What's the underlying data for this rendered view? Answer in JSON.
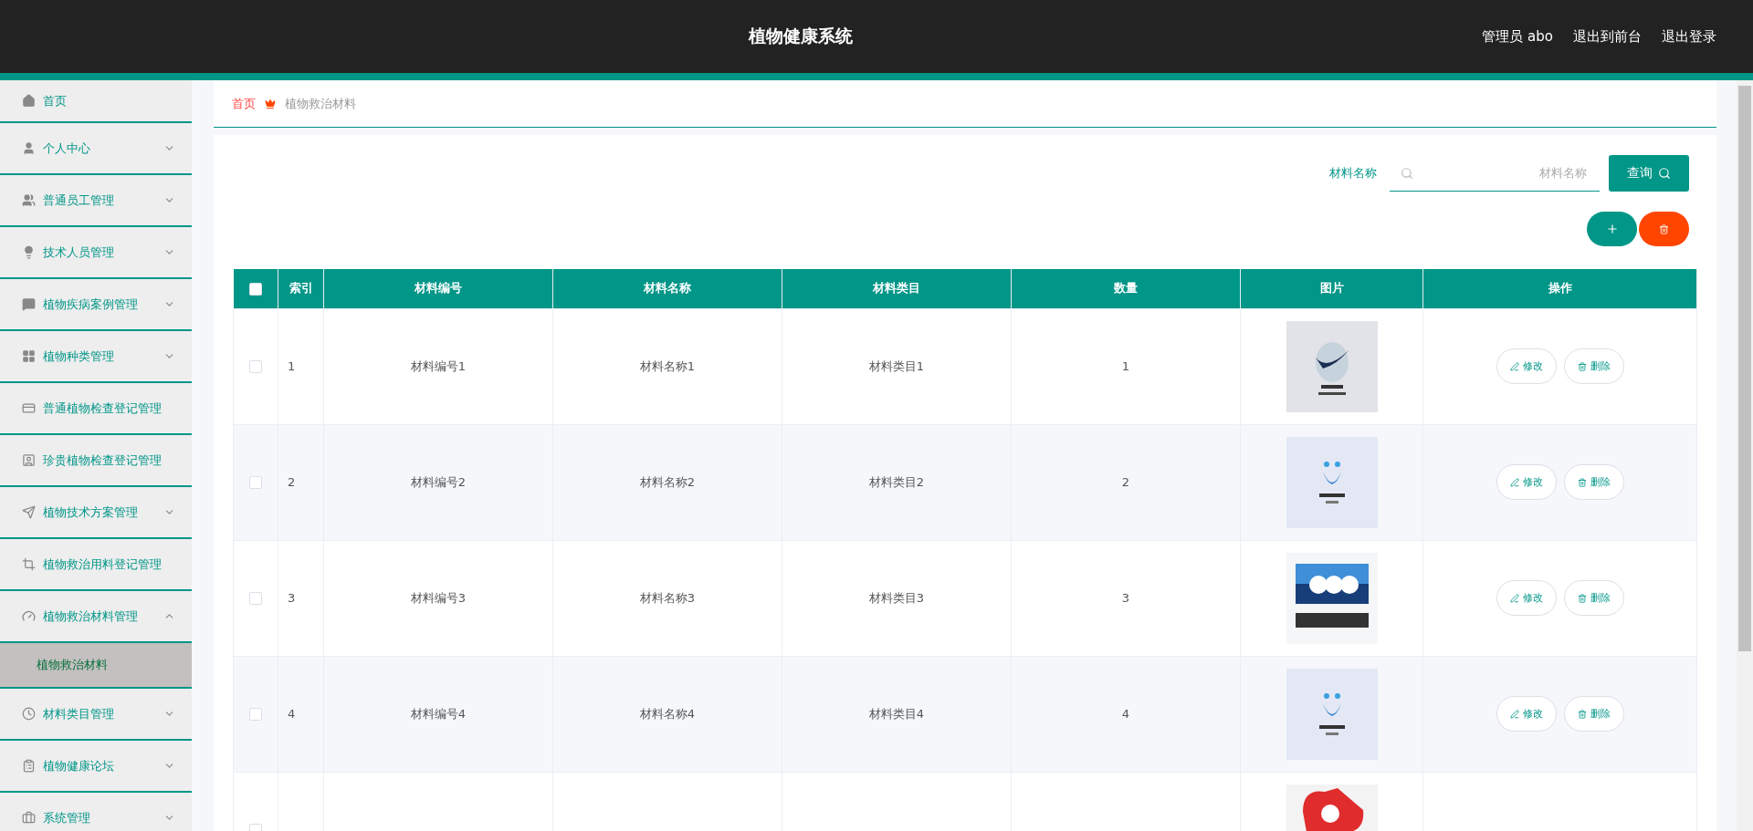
{
  "header": {
    "title": "植物健康系统",
    "links": [
      "管理员 abo",
      "退出到前台",
      "退出登录"
    ]
  },
  "sidebar": {
    "items": [
      {
        "label": "首页"
      },
      {
        "label": "个人中心",
        "expanded": false
      },
      {
        "label": "普通员工管理",
        "expanded": false
      },
      {
        "label": "技术人员管理",
        "expanded": false
      },
      {
        "label": "植物疾病案例管理",
        "expanded": false
      },
      {
        "label": "植物种类管理",
        "expanded": false
      },
      {
        "label": "普通植物检查登记管理"
      },
      {
        "label": "珍贵植物检查登记管理"
      },
      {
        "label": "植物技术方案管理",
        "expanded": false
      },
      {
        "label": "植物救治用料登记管理"
      },
      {
        "label": "植物救治材料管理",
        "expanded": true,
        "children": [
          {
            "label": "植物救治材料",
            "selected": true
          }
        ]
      },
      {
        "label": "材料类目管理",
        "expanded": false
      },
      {
        "label": "植物健康论坛",
        "expanded": false
      },
      {
        "label": "系统管理",
        "expanded": false
      }
    ]
  },
  "breadcrumb": [
    "首页",
    "植物救治材料"
  ],
  "search": {
    "label": "材料名称",
    "placeholder": "材料名称",
    "button": "查询"
  },
  "table": {
    "columns": [
      "索引",
      "材料编号",
      "材料名称",
      "材料类目",
      "数量",
      "图片",
      "操作"
    ],
    "header_checked": false,
    "rows": [
      {
        "checked": false,
        "cells": [
          "1",
          "材料编号1",
          "材料名称1",
          "材料类目1",
          "1"
        ],
        "image": {
          "kind": "picture"
        },
        "actions": [
          "修改",
          "删除"
        ]
      },
      {
        "checked": false,
        "cells": [
          "2",
          "材料编号2",
          "材料名称2",
          "材料类目2",
          "2"
        ],
        "image": {
          "kind": "picture"
        },
        "actions": [
          "修改",
          "删除"
        ]
      },
      {
        "checked": false,
        "cells": [
          "3",
          "材料编号3",
          "材料名称3",
          "材料类目3",
          "3"
        ],
        "image": {
          "kind": "picture"
        },
        "actions": [
          "修改",
          "删除"
        ]
      },
      {
        "checked": false,
        "cells": [
          "4",
          "材料编号4",
          "材料名称4",
          "材料类目4",
          "4"
        ],
        "image": {
          "kind": "picture"
        },
        "actions": [
          "修改",
          "删除"
        ]
      },
      {
        "checked": false,
        "image": {
          "kind": "picture"
        }
      }
    ]
  }
}
